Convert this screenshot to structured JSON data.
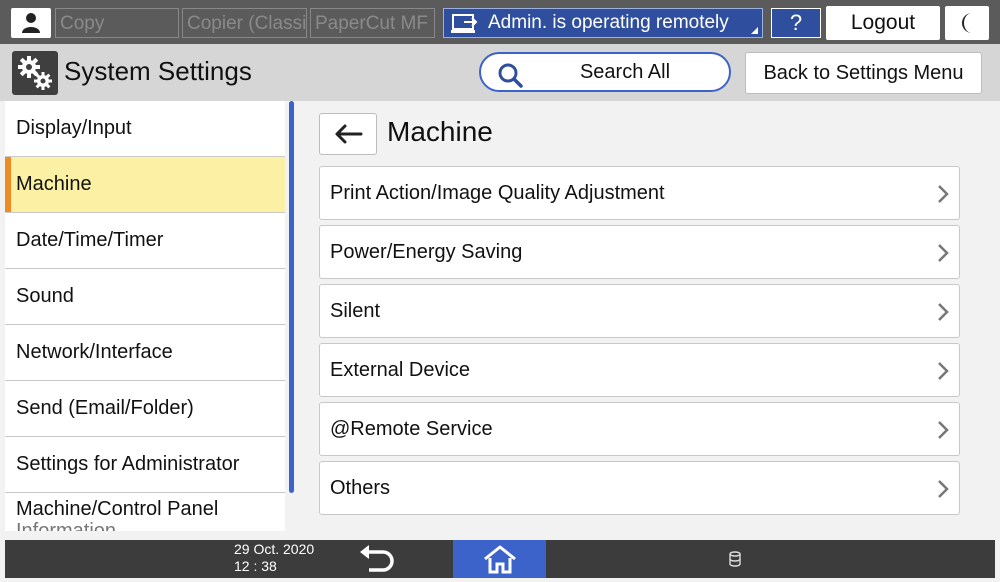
{
  "topbar": {
    "apps": [
      "Copy",
      "Copier (Classic)",
      "PaperCut MF"
    ],
    "remote_status": "Admin. is operating remotely",
    "help_label": "?",
    "logout_label": "Logout"
  },
  "header": {
    "title": "System Settings",
    "search_label": "Search All",
    "back_menu_label": "Back to Settings Menu"
  },
  "sidebar": {
    "items": [
      {
        "label": "Display/Input"
      },
      {
        "label": "Machine",
        "active": true
      },
      {
        "label": "Date/Time/Timer"
      },
      {
        "label": "Sound"
      },
      {
        "label": "Network/Interface"
      },
      {
        "label": "Send (Email/Folder)"
      },
      {
        "label": "Settings for Administrator"
      },
      {
        "label": "Machine/Control Panel",
        "label_line2": "Information"
      }
    ]
  },
  "content": {
    "title": "Machine",
    "items": [
      {
        "label": "Print Action/Image Quality Adjustment"
      },
      {
        "label": "Power/Energy Saving"
      },
      {
        "label": "Silent"
      },
      {
        "label": "External Device"
      },
      {
        "label": "@Remote Service"
      },
      {
        "label": "Others"
      }
    ]
  },
  "statusbar": {
    "date": "29 Oct. 2020",
    "time": "12 : 38"
  },
  "icons": {
    "user": "user-icon",
    "remote": "remote-operation-icon",
    "moon": "night-mode-icon",
    "gear": "settings-gear-icon",
    "search": "search-icon",
    "back": "back-arrow-icon",
    "chevron": "chevron-right-icon",
    "undo": "undo-icon",
    "home": "home-icon",
    "database": "storage-icon"
  },
  "colors": {
    "accent_blue": "#3b63c9",
    "active_bg": "#fbf0a3",
    "active_marker": "#f08a24"
  }
}
